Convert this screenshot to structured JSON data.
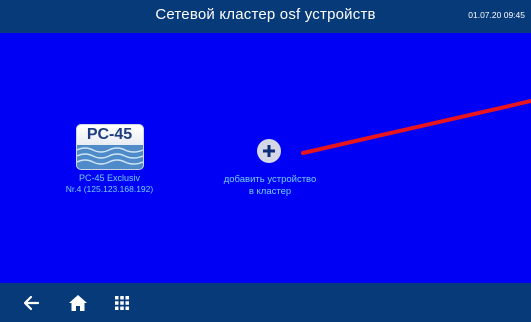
{
  "header": {
    "title": "Сетевой кластер osf устройств",
    "datetime": "01.07.20 09:45"
  },
  "device": {
    "model": "PC-45",
    "name": "PC-45 Exclusiv",
    "address": "Nr.4 (125.123.168.192)"
  },
  "add_device": {
    "label_line1": "добавить устройство",
    "label_line2": "в кластер"
  },
  "navigation": {
    "buttons": [
      "back-arrow-icon",
      "home-icon",
      "grid-menu-icon"
    ]
  },
  "colors": {
    "screen_background": "#0000f4",
    "bars": "#073a78",
    "link_line": "#e8141e",
    "label_text": "#74cffc"
  }
}
